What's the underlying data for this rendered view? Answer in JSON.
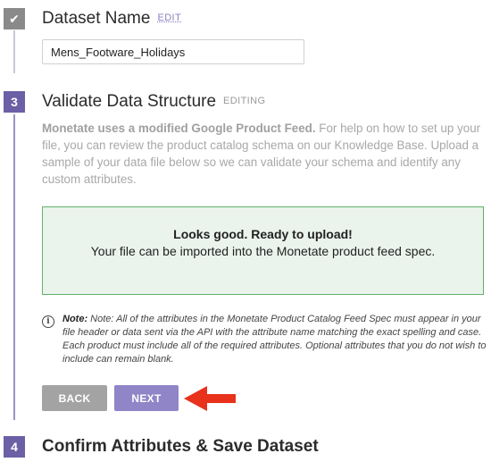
{
  "steps": [
    {
      "number": "✔",
      "title": "Dataset Name",
      "tag": "EDIT"
    },
    {
      "number": "3",
      "title": "Validate Data Structure",
      "tag": "EDITING"
    },
    {
      "number": "4",
      "title": "Confirm Attributes & Save Dataset"
    }
  ],
  "dataset_name": {
    "value": "Mens_Footware_Holidays"
  },
  "description": {
    "bold": "Monetate uses a modified Google Product Feed.",
    "rest": " For help on how to set up your file, you can review the product catalog schema on our Knowledge Base. Upload a sample of your data file below so we can validate your schema and identify any custom attributes."
  },
  "validation": {
    "title": "Looks good. Ready to upload!",
    "message": "Your file can be imported into the Monetate product feed spec."
  },
  "note": {
    "icon_glyph": "i",
    "label": "Note:",
    "text": " Note: All of the attributes in the Monetate Product Catalog Feed Spec must appear in your file header or data sent via the API with the attribute name matching the exact spelling and case. Each product must include all of the required attributes. Optional attributes that you do not wish to include can remain blank."
  },
  "buttons": {
    "back": "BACK",
    "next": "NEXT"
  },
  "colors": {
    "accent": "#6c5fa6",
    "next_button": "#8f85c7",
    "back_button": "#a3a3a3",
    "success_border": "#62b16b",
    "success_bg": "#eaf3ec",
    "arrow": "#e8321c"
  }
}
